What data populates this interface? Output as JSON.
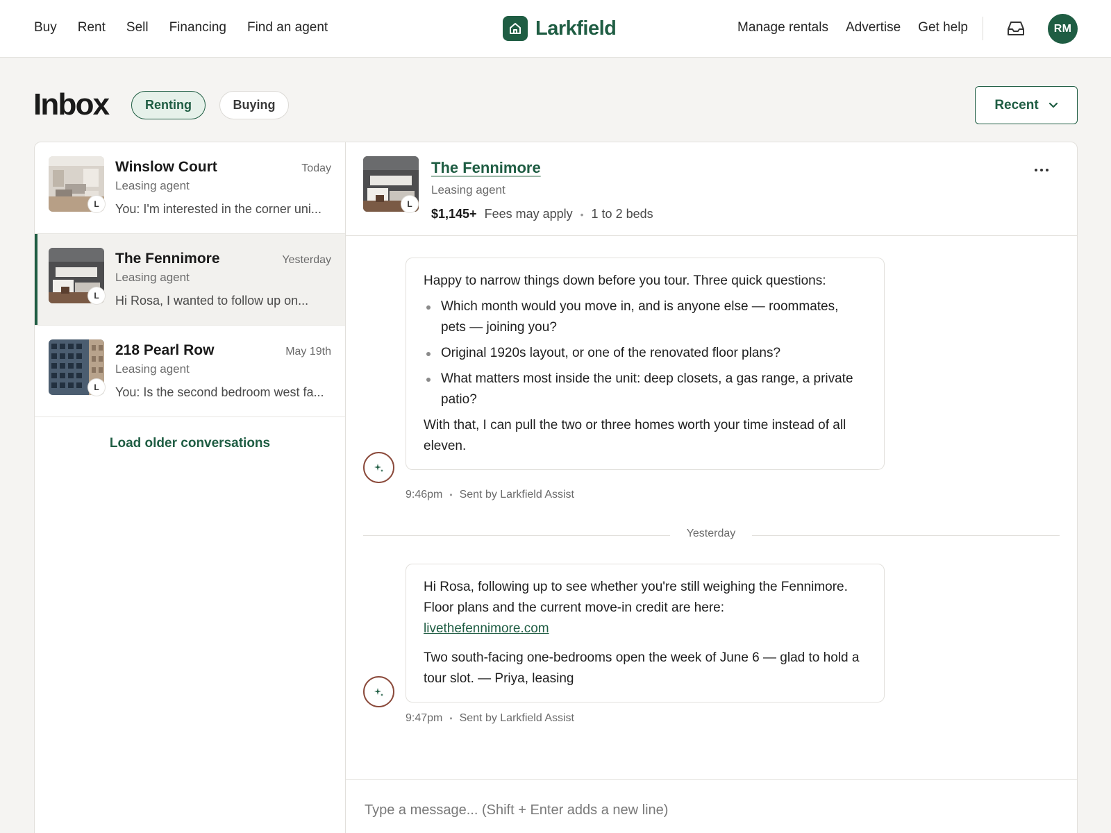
{
  "nav": {
    "left_links": [
      "Buy",
      "Rent",
      "Sell",
      "Financing",
      "Find an agent"
    ],
    "brand": "Larkfield",
    "right_links": [
      "Manage rentals",
      "Advertise",
      "Get help"
    ],
    "avatar_initials": "RM",
    "icons": [
      "home-icon",
      "inbox-tray-icon"
    ]
  },
  "header": {
    "title": "Inbox",
    "filters": [
      "Renting",
      "Buying"
    ],
    "active_filter": "Renting",
    "sort_label": "Recent"
  },
  "conversations": [
    {
      "name": "Winslow Court",
      "date": "Today",
      "role": "Leasing agent",
      "snippet": "You: I'm interested in the corner uni...",
      "badge": "L"
    },
    {
      "name": "The Fennimore",
      "date": "Yesterday",
      "role": "Leasing agent",
      "snippet": "Hi Rosa, I wanted to follow up on...",
      "badge": "L",
      "active": true
    },
    {
      "name": "218 Pearl Row",
      "date": "May 19th",
      "role": "Leasing agent",
      "snippet": "You: Is the second bedroom west fa...",
      "badge": "L"
    }
  ],
  "load_older_label": "Load older conversations",
  "thread": {
    "name": "The Fennimore",
    "role": "Leasing agent",
    "badge": "L",
    "price": "$1,145+",
    "fees": "Fees may apply",
    "beds": "1 to 2 beds",
    "messages": [
      {
        "intro": "Happy to narrow things down before you tour. Three quick questions:",
        "bullets": [
          "Which month would you move in, and is anyone else — roommates, pets — joining you?",
          "Original 1920s layout, or one of the renovated floor plans?",
          "What matters most inside the unit: deep closets, a gas range, a private patio?"
        ],
        "outro": "With that, I can pull the two or three homes worth your time instead of all eleven.",
        "time": "9:46pm",
        "sender": "Sent by Larkfield Assist"
      },
      {
        "p1": "Hi Rosa, following up to see whether you're still weighing the Fennimore. Floor plans and the current move-in credit are here:",
        "link": "livethefennimore.com",
        "p2": "Two south-facing one-bedrooms open the week of June 6 — glad to hold a tour slot. — Priya, leasing",
        "time": "9:47pm",
        "sender": "Sent by Larkfield Assist"
      }
    ],
    "day_divider": "Yesterday",
    "composer_placeholder": "Type a message... (Shift + Enter adds a new line)"
  },
  "colors": {
    "brand": "#1f5d43",
    "assist_ring": "#8b4a3b",
    "background": "#f5f4f2"
  }
}
